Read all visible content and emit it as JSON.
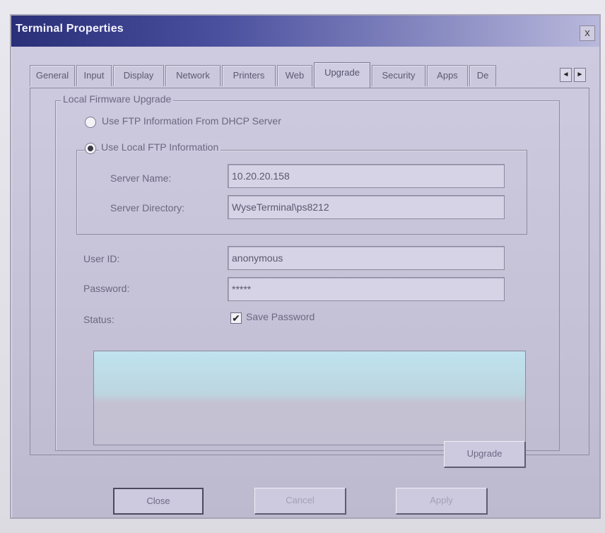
{
  "window": {
    "title": "Terminal Properties",
    "close_glyph": "x"
  },
  "tabs": [
    {
      "label": "General"
    },
    {
      "label": "Input"
    },
    {
      "label": "Display"
    },
    {
      "label": "Network"
    },
    {
      "label": "Printers"
    },
    {
      "label": "Web"
    },
    {
      "label": "Upgrade",
      "active": true
    },
    {
      "label": "Security"
    },
    {
      "label": "Apps"
    },
    {
      "label": "De"
    }
  ],
  "tab_scroll": {
    "left_glyph": "◄",
    "right_glyph": "►"
  },
  "local_firmware": {
    "group_label": "Local Firmware Upgrade",
    "option_dhcp": "Use FTP Information From DHCP Server",
    "option_local": "Use Local FTP Information",
    "selected_option": "local",
    "server_name_label": "Server Name:",
    "server_name_value": "10.20.20.158",
    "server_directory_label": "Server Directory:",
    "server_directory_value": "WyseTerminal\\ps8212"
  },
  "credentials": {
    "user_id_label": "User ID:",
    "user_id_value": "anonymous",
    "password_label": "Password:",
    "password_value": "*****",
    "status_label": "Status:",
    "save_password_label": "Save Password",
    "save_password_checked": true,
    "check_glyph": "✔"
  },
  "status_text": "",
  "buttons": {
    "upgrade": "Upgrade",
    "close": "Close",
    "cancel": "Cancel",
    "apply": "Apply"
  }
}
